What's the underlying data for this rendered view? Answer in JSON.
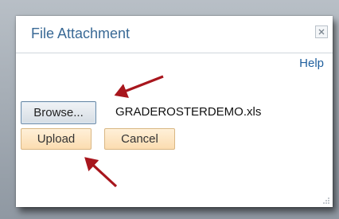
{
  "dialog": {
    "title": "File Attachment",
    "help_label": "Help",
    "browse_label": "Browse...",
    "file_name": "GRADEROSTERDEMO.xls",
    "upload_label": "Upload",
    "cancel_label": "Cancel"
  },
  "icons": {
    "close": "close-icon",
    "resize": "resize-grip-icon",
    "annotation": "red-arrow"
  },
  "colors": {
    "title": "#3a6a96",
    "link": "#1f5f9e",
    "button_orange": "#fbdcb0",
    "annotation_arrow": "#a8161d"
  }
}
